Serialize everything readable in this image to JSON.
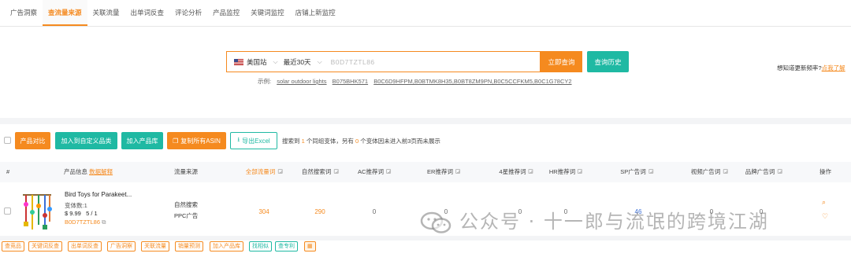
{
  "tabs": [
    {
      "label": "广告洞察",
      "active": false
    },
    {
      "label": "查流量来源",
      "active": true
    },
    {
      "label": "关联流量",
      "active": false
    },
    {
      "label": "出单词反查",
      "active": false
    },
    {
      "label": "评论分析",
      "active": false
    },
    {
      "label": "产品监控",
      "active": false
    },
    {
      "label": "关键词监控",
      "active": false
    },
    {
      "label": "店铺上新监控",
      "active": false
    }
  ],
  "search": {
    "site": "美国站",
    "period": "最近30天",
    "value": "B0D7TZTL86",
    "query_button": "立即查询",
    "history_button": "查询历史",
    "examples_label": "示例:",
    "examples": [
      "solar outdoor lights",
      "B075BHK571",
      "B0C6D9HFPM,B0BTMK8H35,B0BT8ZM9PN,B0C5CCFKM5,B0C1G78CY2"
    ],
    "freq_text": "想知道更新频率?",
    "freq_link": "点我了解"
  },
  "toolbar": {
    "compare": "产品对比",
    "add_category": "加入到自定义品类",
    "add_library": "加入产品库",
    "copy_asin": "复制所有ASIN",
    "export": "导出Excel",
    "summary_pre": "搜索到",
    "summary_count1": "1",
    "summary_mid": "个同组变体，另有",
    "summary_count2": "0",
    "summary_post": "个变体因未进入前3页而未展示"
  },
  "table": {
    "headers": {
      "index": "#",
      "product": "产品信息",
      "product_link": "数据解释",
      "source": "流量来源",
      "all_kw": "全部流量词",
      "organic": "自然搜索词",
      "ac": "AC推荐词",
      "er": "ER推荐词",
      "star4": "4星推荐词",
      "hr": "HR推荐词",
      "sp": "SP广告词",
      "video": "视频广告词",
      "brand": "品牌广告词",
      "op": "操作"
    },
    "row": {
      "name": "Bird Toys for Parakeet...",
      "variants": "变体数:1",
      "price": "$ 9.99",
      "rating": "5 / 1",
      "asin": "B0D7TZTL86",
      "source1": "自然搜索",
      "source2": "PPC广告",
      "all_kw": "304",
      "organic": "290",
      "ac": "0",
      "er": "0",
      "star4": "0",
      "hr": "0",
      "sp": "46",
      "video": "0",
      "brand": "0"
    }
  },
  "actions": [
    "查竞品",
    "关键词反查",
    "出单词反查",
    "广告洞察",
    "关联流量",
    "销量预测",
    "加入产品库",
    "找相似",
    "查专利"
  ],
  "watermark": "公众号 · 十一郎与流氓的跨境江湖",
  "colors": {
    "accent": "#f58a1f",
    "teal": "#1fb9a3",
    "blue": "#3a6fd8"
  }
}
